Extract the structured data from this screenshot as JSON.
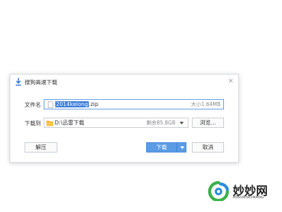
{
  "window": {
    "title": "搜狗高速下载",
    "close_glyph": "×",
    "icon": "download-arrow-icon"
  },
  "file": {
    "label": "文件名",
    "name_selected": "2014kelong",
    "name_ext": ".zip",
    "size": "大小1.64MB",
    "icon": "file-icon"
  },
  "destination": {
    "label": "下载到",
    "path": "D:\\迅雷下载",
    "free_space": "剩余85.8GB",
    "icon": "folder-icon",
    "browse_label": "浏览..."
  },
  "actions": {
    "extract_label": "解压",
    "download_label": "下载",
    "cancel_label": "取消"
  },
  "watermark": {
    "text_cn": "妙妙网",
    "text_en": "MIAOMIAOWANG",
    "colors": {
      "green": "#3cb24a",
      "blue": "#2a8fd6"
    }
  },
  "colors": {
    "accent": "#5b9be5",
    "selection": "#3a7ddb"
  }
}
